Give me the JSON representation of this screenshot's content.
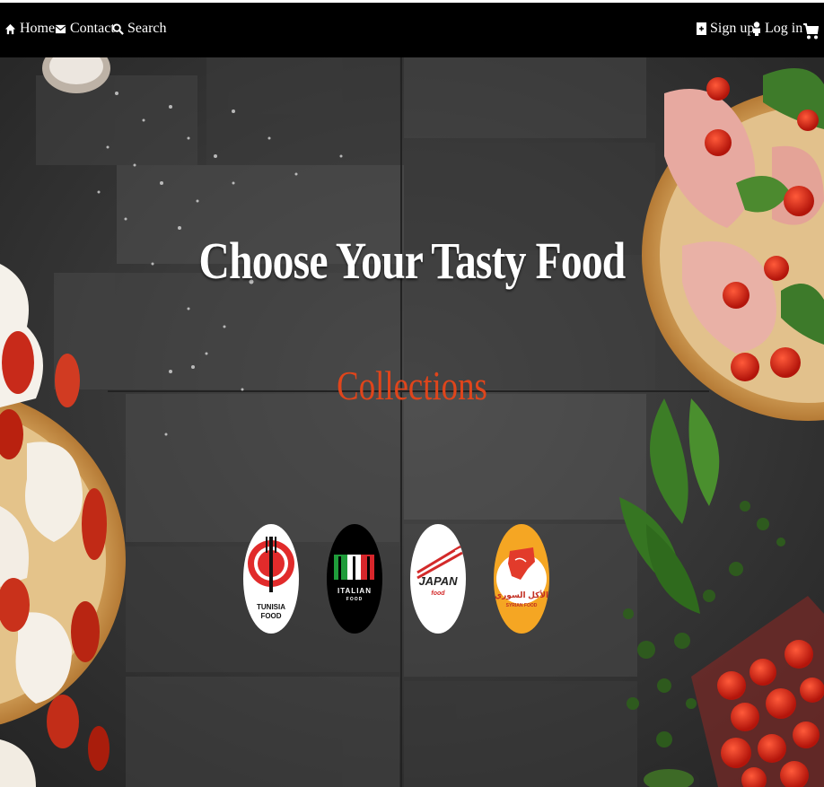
{
  "nav": {
    "home": "Home",
    "contact": "Contact",
    "search": "Search",
    "signup": "Sign up",
    "login": "Log in"
  },
  "hero": {
    "title": "Choose Your Tasty Food",
    "subtitle": "Collections"
  },
  "collections": [
    {
      "name": "tunisia",
      "line1": "TUNISIA",
      "line2": "FOOD"
    },
    {
      "name": "italian",
      "line1": "ITALIAN",
      "line2": "FOOD"
    },
    {
      "name": "japan",
      "line1": "JAPAN",
      "line2": "food"
    },
    {
      "name": "syrian",
      "line1": "الأكل السوري",
      "line2": "SYRIAN FOOD"
    }
  ],
  "colors": {
    "navbar": "#000000",
    "accent": "#e0451b",
    "background": "#3a3a3a"
  }
}
